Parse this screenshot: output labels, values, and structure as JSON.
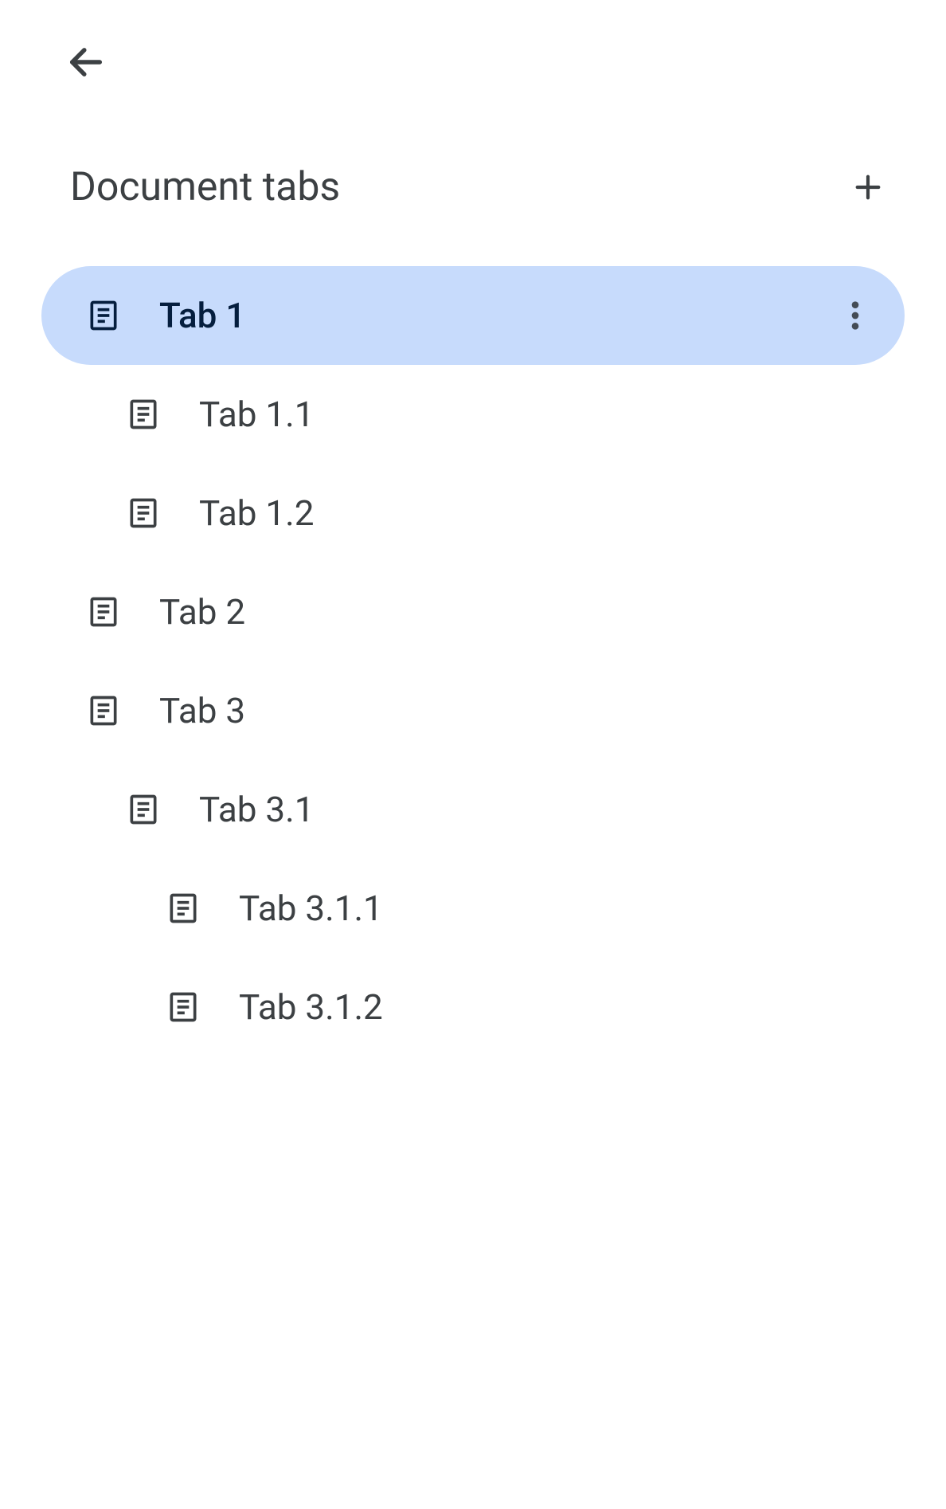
{
  "header": {
    "title": "Document tabs"
  },
  "tabs": [
    {
      "label": "Tab 1",
      "indent": 0,
      "selected": true
    },
    {
      "label": "Tab 1.1",
      "indent": 1,
      "selected": false
    },
    {
      "label": "Tab 1.2",
      "indent": 1,
      "selected": false
    },
    {
      "label": "Tab 2",
      "indent": 0,
      "selected": false
    },
    {
      "label": "Tab 3",
      "indent": 0,
      "selected": false
    },
    {
      "label": "Tab 3.1",
      "indent": 1,
      "selected": false
    },
    {
      "label": "Tab 3.1.1",
      "indent": 2,
      "selected": false
    },
    {
      "label": "Tab 3.1.2",
      "indent": 2,
      "selected": false
    }
  ],
  "colors": {
    "selected_bg": "#c7dbfc",
    "text": "#3c4043",
    "selected_text": "#051e3e"
  }
}
